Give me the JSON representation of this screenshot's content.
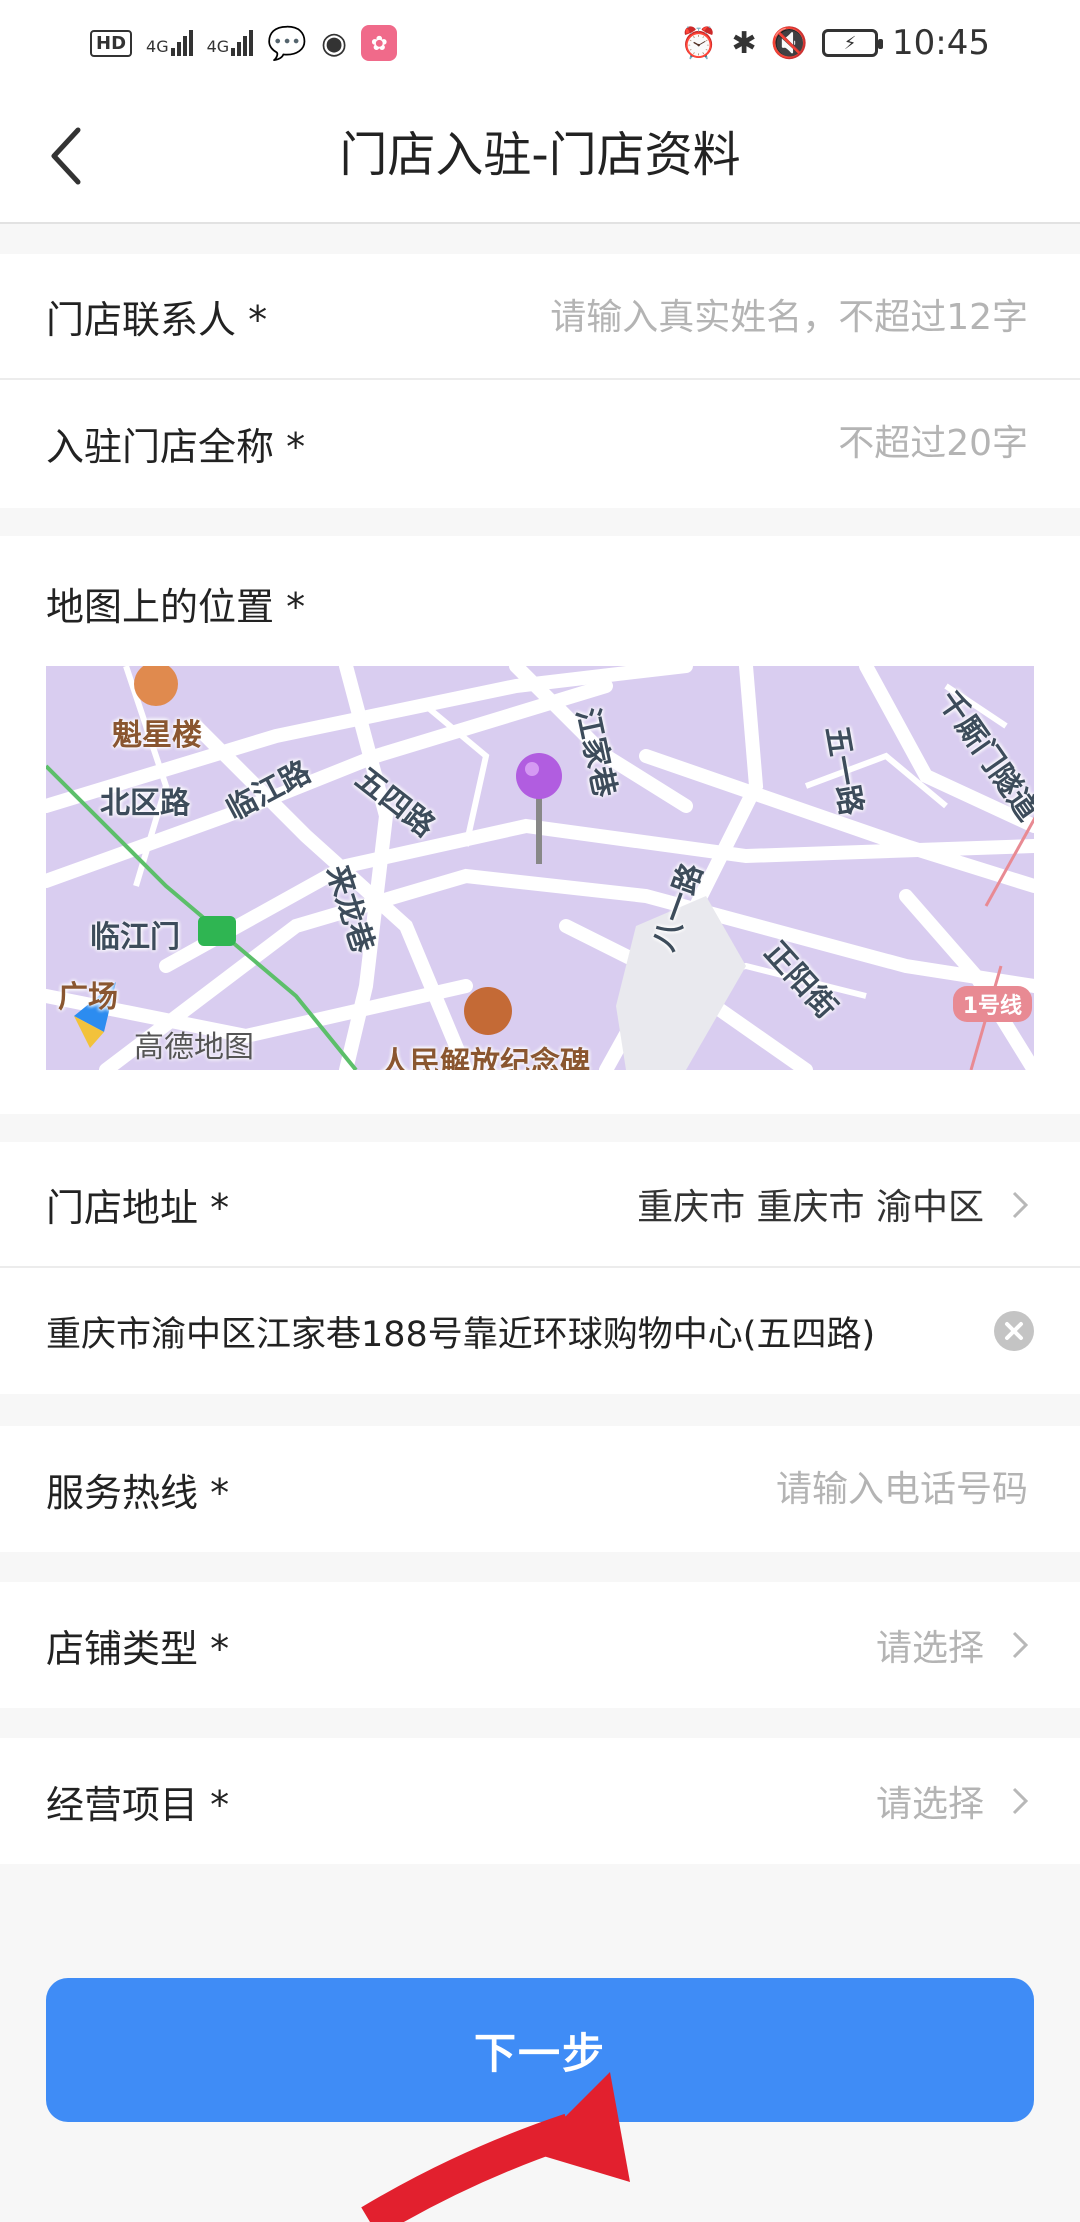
{
  "status_bar": {
    "hd": "HD",
    "net1": "4G",
    "net2": "4G",
    "time": "10:45"
  },
  "nav": {
    "title": "门店入驻-门店资料"
  },
  "form": {
    "contact": {
      "label": "门店联系人 *",
      "placeholder": "请输入真实姓名，不超过12字",
      "value": ""
    },
    "fullname": {
      "label": "入驻门店全称 *",
      "placeholder": "不超过20字",
      "value": ""
    },
    "map": {
      "label": "地图上的位置 *",
      "labels": [
        "魁星楼",
        "北区路",
        "临江路",
        "五四路",
        "来龙巷",
        "江家巷",
        "五一路",
        "千厮门隧道",
        "八一路",
        "正阳街",
        "临江门",
        "人民解放纪念碑",
        "广场"
      ],
      "logo": "高德地图",
      "line_badge": "1号线"
    },
    "address_region": {
      "label": "门店地址 *",
      "value": "重庆市 重庆市 渝中区"
    },
    "address_detail": {
      "value": "重庆市渝中区江家巷188号靠近环球购物中心(五四路)"
    },
    "hotline": {
      "label": "服务热线 *",
      "placeholder": "请输入电话号码",
      "value": ""
    },
    "shop_type": {
      "label": "店铺类型 *",
      "value": "请选择"
    },
    "business": {
      "label": "经营项目 *",
      "value": "请选择"
    }
  },
  "footer": {
    "next_label": "下一步"
  },
  "colors": {
    "primary": "#3f8cf6",
    "map_bg": "#d9cdf0",
    "pin": "#b15de0",
    "annotation_arrow": "#e2202e"
  }
}
